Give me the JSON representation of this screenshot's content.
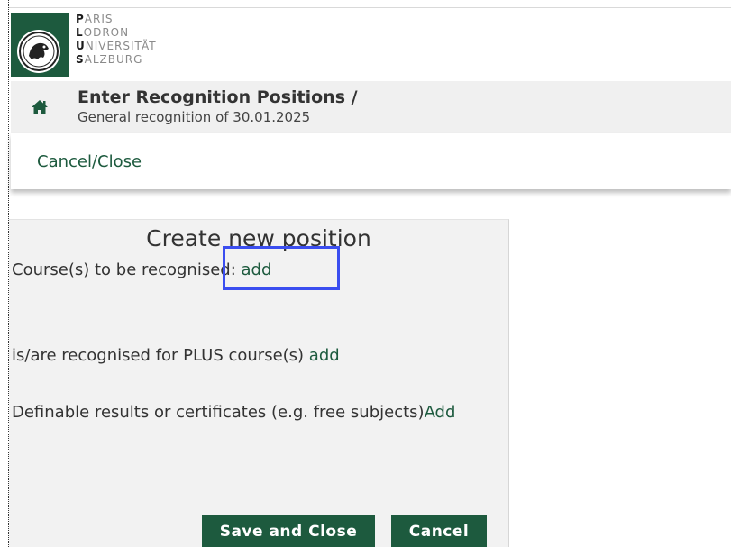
{
  "logo": {
    "lines": [
      {
        "initial": "P",
        "rest": "ARIS"
      },
      {
        "initial": "L",
        "rest": "ODRON"
      },
      {
        "initial": "U",
        "rest": "NIVERSITÄT"
      },
      {
        "initial": "S",
        "rest": "ALZBURG"
      }
    ],
    "brand_color": "#1d5a3e"
  },
  "header": {
    "icon": "home-icon",
    "title": "Enter Recognition Positions  /",
    "subtitle": "General recognition of 30.01.2025"
  },
  "actions": {
    "cancel_close_label": "Cancel/Close"
  },
  "form": {
    "title": "Create new position",
    "courses_label": "Course(s) to be recognised: ",
    "courses_add": "add",
    "plus_label": "is/are recognised for PLUS course(s) ",
    "plus_add": "add",
    "definable_label": "Definable results or certificates (e.g. free subjects)",
    "definable_add": "Add",
    "save_close_label": "Save and Close",
    "cancel_label": "Cancel"
  },
  "colors": {
    "accent": "#1d5a3e",
    "highlight": "#3b4ef0"
  }
}
